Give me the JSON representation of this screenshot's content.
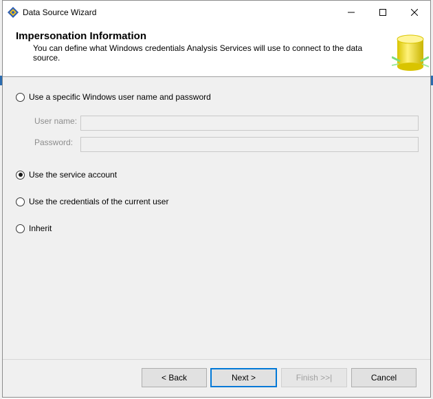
{
  "window": {
    "title": "Data Source Wizard"
  },
  "header": {
    "title": "Impersonation Information",
    "description": "You can define what Windows credentials Analysis Services will use to connect to the data source."
  },
  "options": {
    "specific_user": {
      "label": "Use a specific Windows user name and password",
      "checked": false
    },
    "service_account": {
      "label": "Use the service account",
      "checked": true
    },
    "current_user": {
      "label": "Use the credentials of the current user",
      "checked": false
    },
    "inherit": {
      "label": "Inherit",
      "checked": false
    }
  },
  "fields": {
    "username": {
      "label": "User name:",
      "value": ""
    },
    "password": {
      "label": "Password:",
      "value": ""
    }
  },
  "buttons": {
    "back": "< Back",
    "next": "Next >",
    "finish": "Finish >>|",
    "cancel": "Cancel"
  },
  "icons": {
    "app": "data-source-wizard-icon",
    "header": "database-cylinder-icon"
  },
  "colors": {
    "accent": "#0078d7",
    "header_bg": "#ffffff",
    "body_bg": "#f0f0f0"
  }
}
